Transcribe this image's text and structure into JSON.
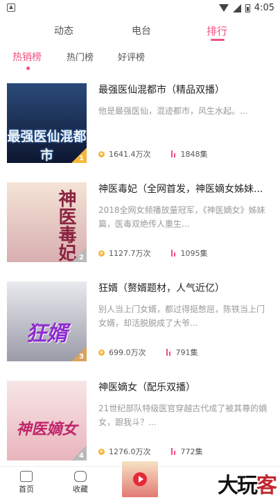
{
  "status": {
    "time": "4:05"
  },
  "top_tabs": [
    {
      "label": "动态"
    },
    {
      "label": "电台"
    },
    {
      "label": "排行"
    }
  ],
  "sub_tabs": [
    {
      "label": "热销榜"
    },
    {
      "label": "热门榜"
    },
    {
      "label": "好评榜"
    }
  ],
  "items": [
    {
      "rank": "1",
      "cover_text": "最强医仙混都市",
      "title": "最强医仙混都市（精品双播）",
      "desc": "他是最强医仙，混迹都市，风生水起。...",
      "plays": "1641.4万次",
      "episodes": "1848集",
      "cover_bg": "#1b2c52"
    },
    {
      "rank": "2",
      "cover_text": "神医毒妃",
      "title": "神医毒妃（全网首发，神医嫡女姊妹...",
      "desc": "2018全网女频播放量冠军，《神医嫡女》姊妹篇，医毒双绝传人重生...",
      "plays": "1127.7万次",
      "episodes": "1095集",
      "cover_bg": "#efd6c4"
    },
    {
      "rank": "3",
      "cover_text": "狂婿",
      "title": "狂婿（赘婿题材，人气近亿）",
      "desc": "别人当上门女婿，都过得挺憋屈，陈铁当上门女婿，却活脱脱成了大爷...",
      "plays": "699.0万次",
      "episodes": "791集",
      "cover_bg": "#dadbe0"
    },
    {
      "rank": "4",
      "cover_text": "神医嫡女",
      "title": "神医嫡女（配乐双播）",
      "desc": "21世纪部队特级医官穿越古代成了被其尊的嫡女，跟我斗？...",
      "plays": "1276.0万次",
      "episodes": "772集",
      "cover_bg": "#f2d2d6"
    }
  ],
  "bottom_nav": [
    {
      "label": "首页"
    },
    {
      "label": "收藏"
    }
  ],
  "watermark": {
    "text_black": "大玩",
    "text_red": "客"
  },
  "colors": {
    "accent": "#f0507e",
    "crown": "#f6b73c"
  }
}
